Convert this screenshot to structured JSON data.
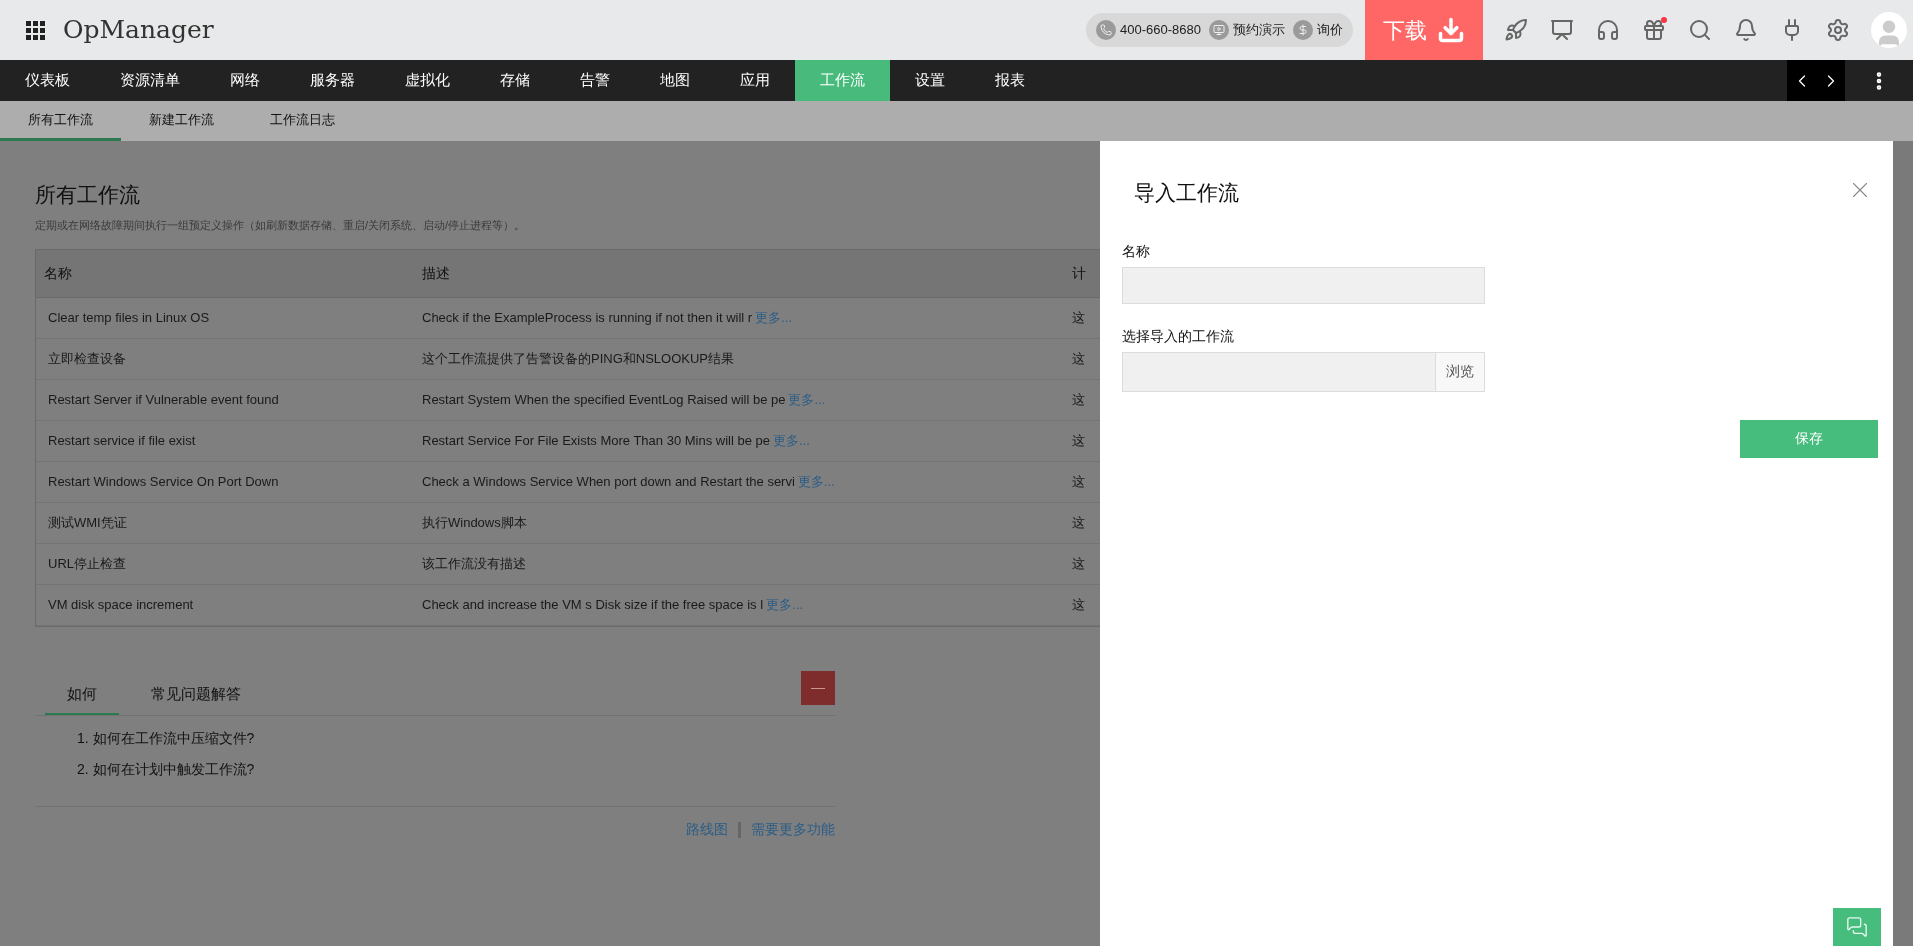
{
  "header": {
    "app_name": "OpManager",
    "phone": "400-660-8680",
    "demo": "预约演示",
    "pricing": "询价",
    "download": "下载",
    "gift_badge": true
  },
  "nav": [
    {
      "label": "仪表板",
      "selected": false
    },
    {
      "label": "资源清单",
      "selected": false
    },
    {
      "label": "网络",
      "selected": false
    },
    {
      "label": "服务器",
      "selected": false
    },
    {
      "label": "虚拟化",
      "selected": false
    },
    {
      "label": "存储",
      "selected": false
    },
    {
      "label": "告警",
      "selected": false
    },
    {
      "label": "地图",
      "selected": false
    },
    {
      "label": "应用",
      "selected": false
    },
    {
      "label": "工作流",
      "selected": true
    },
    {
      "label": "设置",
      "selected": false
    },
    {
      "label": "报表",
      "selected": false
    }
  ],
  "subnav": [
    {
      "label": "所有工作流",
      "selected": true
    },
    {
      "label": "新建工作流",
      "selected": false
    },
    {
      "label": "工作流日志",
      "selected": false
    }
  ],
  "page": {
    "title": "所有工作流",
    "subtitle": "定期或在网络故障期间执行一组预定义操作（如刷新数据存储、重启/关闭系统、启动/停止进程等）。"
  },
  "table": {
    "columns": [
      "名称",
      "描述",
      "计"
    ],
    "rows": [
      {
        "name": "Clear temp files in Linux OS",
        "description": "Check if the ExampleProcess is running if not then it will r",
        "more": "更多...",
        "column_3": "这"
      },
      {
        "name": "立即检查设备",
        "description": "这个工作流提供了告警设备的PING和NSLOOKUP结果",
        "column_3": "这"
      },
      {
        "name": "Restart Server if Vulnerable event found",
        "description": "Restart System When the specified EventLog Raised will be pe",
        "more": "更多...",
        "column_3": "这"
      },
      {
        "name": "Restart service if file exist",
        "description": "Restart Service For File Exists More Than 30 Mins will be pe",
        "more": "更多...",
        "column_3": "这"
      },
      {
        "name": "Restart Windows Service On Port Down",
        "description": "Check a Windows Service When port down and Restart the servi",
        "more": "更多...",
        "column_3": "这"
      },
      {
        "name": "测试WMI凭证",
        "description": "执行Windows脚本",
        "column_3": "这"
      },
      {
        "name": "URL停止检查",
        "description": "该工作流没有描述",
        "column_3": "这"
      },
      {
        "name": "VM disk space increment",
        "description": "Check and increase the VM s Disk size if the free space is l",
        "more": "更多...",
        "column_3": "这"
      }
    ]
  },
  "help": {
    "tabs": [
      {
        "label": "如何",
        "selected": true
      },
      {
        "label": "常见问题解答",
        "selected": false
      }
    ],
    "items": [
      "1. 如何在工作流中压缩文件?",
      "2. 如何在计划中触发工作流?"
    ],
    "links": [
      "路线图",
      "需要更多功能"
    ]
  },
  "dialog": {
    "title": "导入工作流",
    "name_label": "名称",
    "file_label": "选择导入的工作流",
    "browse": "浏览",
    "save": "保存"
  }
}
